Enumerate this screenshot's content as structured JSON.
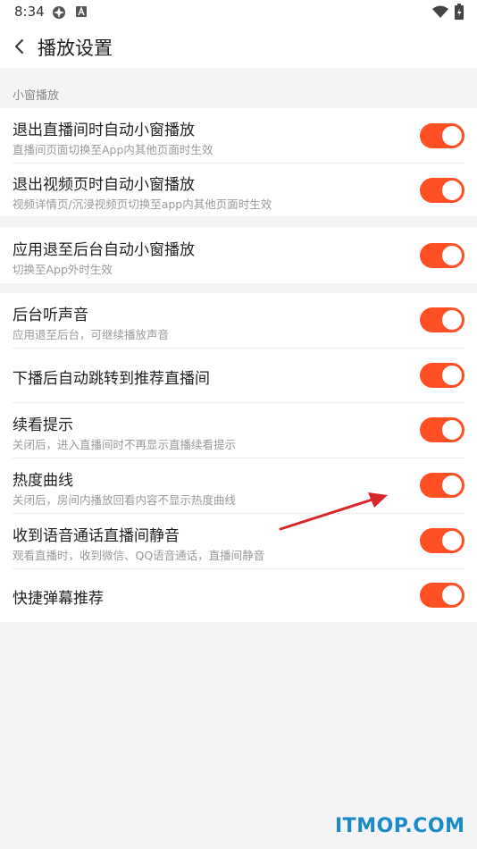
{
  "status_bar": {
    "time": "8:34"
  },
  "header": {
    "title": "播放设置"
  },
  "section": {
    "label": "小窗播放"
  },
  "items": [
    {
      "title": "退出直播间时自动小窗播放",
      "subtitle": "直播间页面切换至App内其他页面时生效",
      "enabled": true
    },
    {
      "title": "退出视频页时自动小窗播放",
      "subtitle": "视频详情页/沉浸视频页切换至app内其他页面时生效",
      "enabled": true
    },
    {
      "title": "应用退至后台自动小窗播放",
      "subtitle": "切换至App外时生效",
      "enabled": true
    },
    {
      "title": "后台听声音",
      "subtitle": "应用退至后台，可继续播放声音",
      "enabled": true
    },
    {
      "title": "下播后自动跳转到推荐直播间",
      "subtitle": "",
      "enabled": true
    },
    {
      "title": "续看提示",
      "subtitle": "关闭后，进入直播间时不再显示直播续看提示",
      "enabled": true
    },
    {
      "title": "热度曲线",
      "subtitle": "关闭后，房间内播放回看内容不显示热度曲线",
      "enabled": true
    },
    {
      "title": "收到语音通话直播间静音",
      "subtitle": "观看直播时，收到微信、QQ语音通话，直播间静音",
      "enabled": true
    },
    {
      "title": "快捷弹幕推荐",
      "subtitle": "",
      "enabled": true
    }
  ],
  "colors": {
    "toggle_on": "#ff4f25",
    "annotation_arrow": "#d9262b",
    "watermark": "#1a8bc4"
  },
  "watermark": "ITMOP.COM"
}
